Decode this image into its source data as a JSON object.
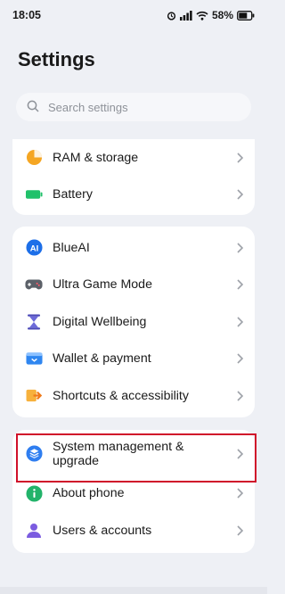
{
  "status": {
    "time": "18:05",
    "battery": "58%"
  },
  "page_title": "Settings",
  "search": {
    "placeholder": "Search settings"
  },
  "groups": [
    {
      "items": [
        {
          "label": "RAM & storage",
          "icon": "pie-chart-icon"
        },
        {
          "label": "Battery",
          "icon": "battery-icon"
        }
      ]
    },
    {
      "items": [
        {
          "label": "BlueAI",
          "icon": "ai-icon"
        },
        {
          "label": "Ultra Game Mode",
          "icon": "gamepad-icon"
        },
        {
          "label": "Digital Wellbeing",
          "icon": "hourglass-icon"
        },
        {
          "label": "Wallet & payment",
          "icon": "wallet-icon"
        },
        {
          "label": "Shortcuts & accessibility",
          "icon": "shortcut-icon"
        }
      ]
    },
    {
      "items": [
        {
          "label": "System management & upgrade",
          "icon": "layers-icon",
          "highlighted": true
        },
        {
          "label": "About phone",
          "icon": "info-icon"
        },
        {
          "label": "Users & accounts",
          "icon": "user-icon"
        }
      ]
    }
  ],
  "colors": {
    "highlight": "#d0102a",
    "accent": "#2b6ee8"
  }
}
